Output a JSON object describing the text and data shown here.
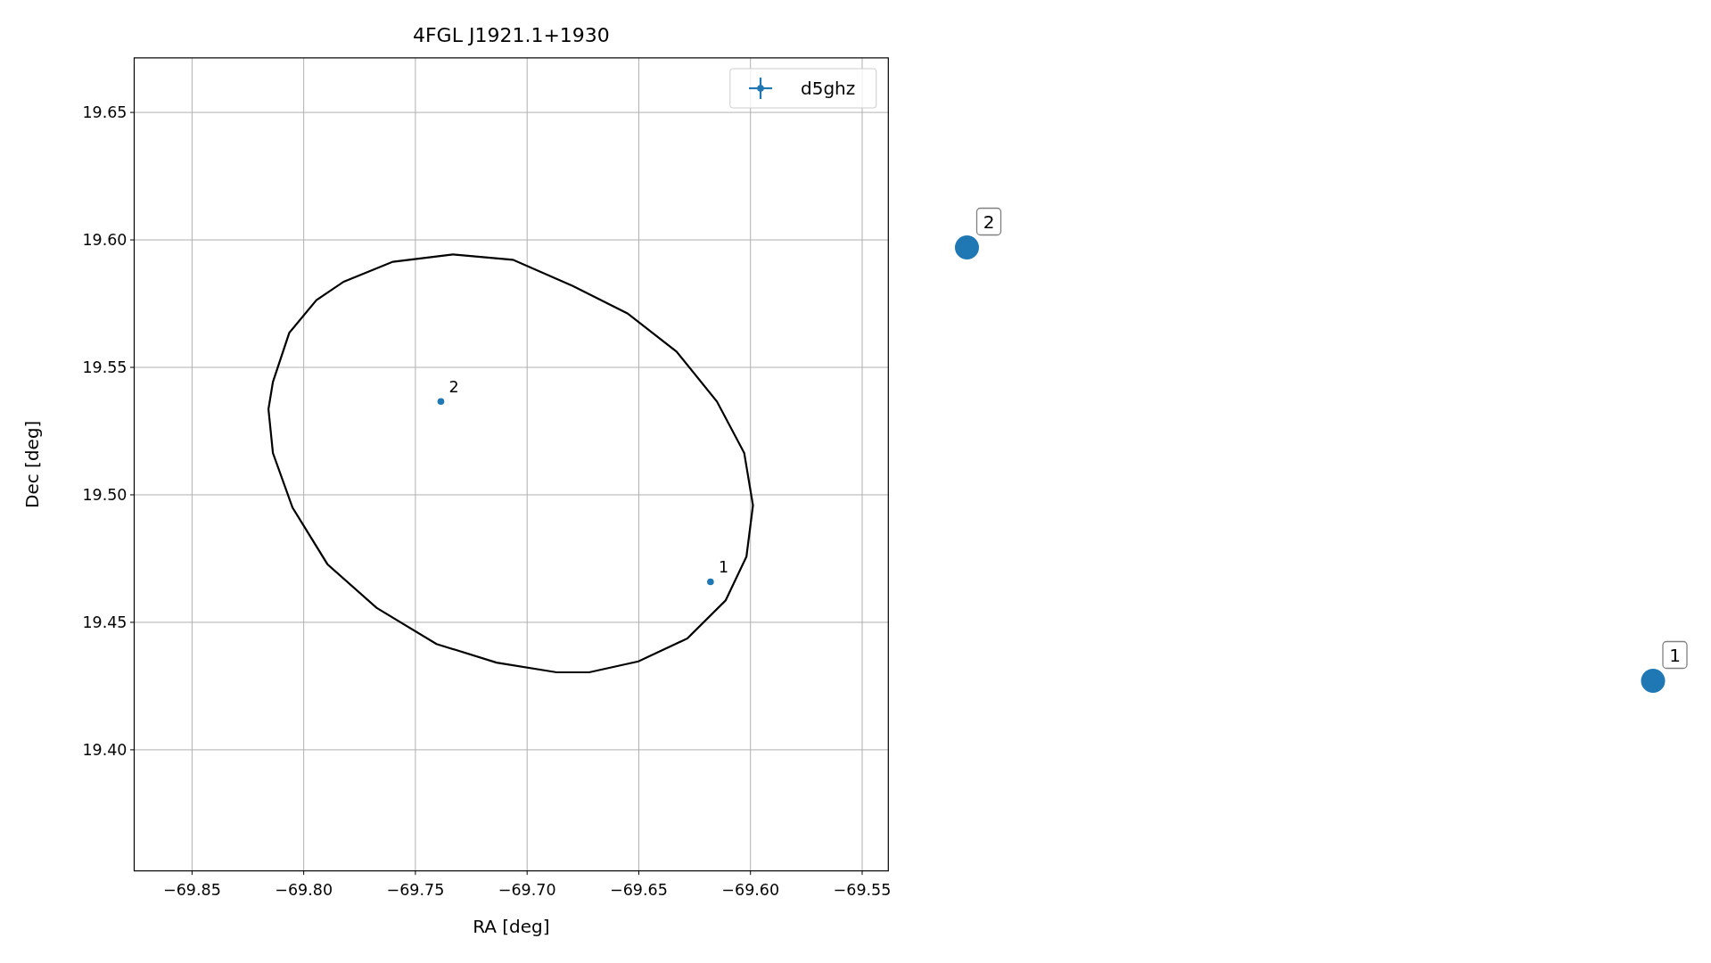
{
  "figure": {
    "chart_data": {
      "type": "scatter",
      "title": "4FGL J1921.1+1930",
      "xlabel": "RA [deg]",
      "ylabel": "Dec [deg]",
      "grid": true,
      "xlim": [
        -69.8759,
        -69.5383
      ],
      "ylim": [
        19.3525,
        19.6714
      ],
      "xticks": [
        {
          "value": -69.85,
          "label": "−69.85"
        },
        {
          "value": -69.8,
          "label": "−69.80"
        },
        {
          "value": -69.75,
          "label": "−69.75"
        },
        {
          "value": -69.7,
          "label": "−69.70"
        },
        {
          "value": -69.65,
          "label": "−69.65"
        },
        {
          "value": -69.6,
          "label": "−69.60"
        },
        {
          "value": -69.55,
          "label": "−69.55"
        }
      ],
      "yticks": [
        {
          "value": 19.4,
          "label": "19.40"
        },
        {
          "value": 19.45,
          "label": "19.45"
        },
        {
          "value": 19.5,
          "label": "19.50"
        },
        {
          "value": 19.55,
          "label": "19.55"
        },
        {
          "value": 19.6,
          "label": "19.60"
        },
        {
          "value": 19.65,
          "label": "19.65"
        }
      ],
      "series": [
        {
          "name": "d5ghz",
          "color": "#1f77b4",
          "x": [
            -69.6179,
            -69.7386
          ],
          "values": [
            19.4659,
            19.5366
          ]
        }
      ],
      "annotations": [
        {
          "text": "1",
          "x": -69.6179,
          "y": 19.4659
        },
        {
          "text": "2",
          "x": -69.7386,
          "y": 19.5366
        }
      ]
    },
    "outside_markers": [
      {
        "label": "2"
      },
      {
        "label": "1"
      }
    ]
  }
}
